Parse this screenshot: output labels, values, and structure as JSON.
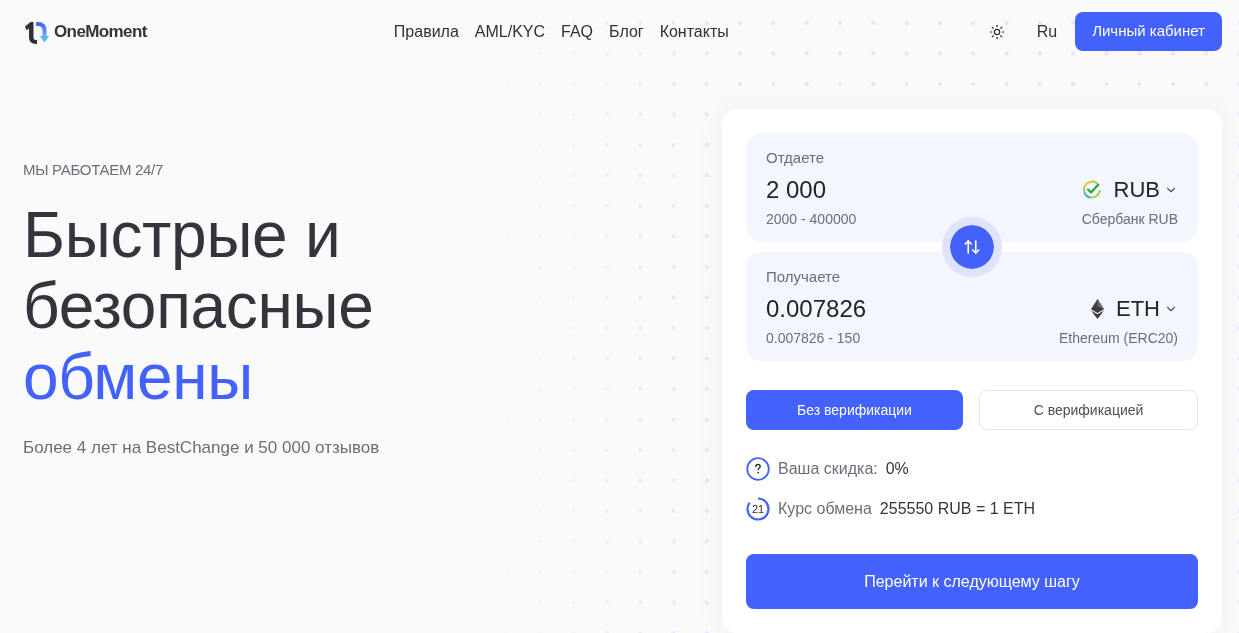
{
  "header": {
    "logo": "OneMoment",
    "nav": [
      "Правила",
      "AML/KYC",
      "FAQ",
      "Блог",
      "Контакты"
    ],
    "language": "Ru",
    "account_button": "Личный кабинет"
  },
  "hero": {
    "eyebrow": "МЫ РАБОТАЕМ 24/7",
    "title_lines": [
      {
        "text": "Быстрые и",
        "accent": false
      },
      {
        "text": "безопасные",
        "accent": false
      },
      {
        "text": "обмены",
        "accent": true
      }
    ],
    "subtitle": "Более 4 лет на BestChange и 50 000 отзывов"
  },
  "exchange": {
    "give": {
      "label": "Отдаете",
      "amount": "2 000",
      "range": "2000 - 400000",
      "currency": "RUB",
      "kind": "sber",
      "network": "Сбербанк RUB"
    },
    "receive": {
      "label": "Получаете",
      "amount": "0.007826",
      "range": "0.007826 - 150",
      "currency": "ETH",
      "kind": "eth",
      "network": "Ethereum (ERC20)"
    },
    "modes": [
      {
        "label": "Без верификации",
        "selected": true
      },
      {
        "label": "С верификацией",
        "selected": false
      }
    ],
    "discount": {
      "label": "Ваша скидка:",
      "value": "0%"
    },
    "rate": {
      "timer": "21",
      "label": "Курс обмена",
      "value": "255550 RUB = 1 ETH"
    },
    "submit": "Перейти к следующему шагу"
  }
}
